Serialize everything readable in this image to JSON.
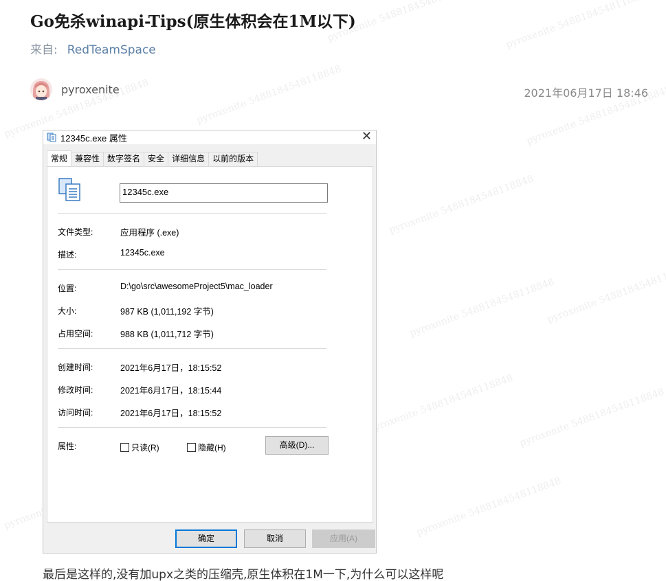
{
  "post": {
    "title": "Go免杀winapi-Tips(原生体积会在1M以下)",
    "source_label": "来自:",
    "source_name": "RedTeamSpace",
    "author": "pyroxenite",
    "date": "2021年06月17日 18:46",
    "body_text": "最后是这样的,没有加upx之类的压缩壳,原生体积在1M一下,为什么可以这样呢"
  },
  "watermark_text": "pyroxenite 5488184548118848",
  "dialog": {
    "title": "12345c.exe 属性",
    "close_glyph": "✕",
    "tabs": [
      {
        "label": "常规",
        "active": true
      },
      {
        "label": "兼容性",
        "active": false
      },
      {
        "label": "数字签名",
        "active": false
      },
      {
        "label": "安全",
        "active": false
      },
      {
        "label": "详细信息",
        "active": false
      },
      {
        "label": "以前的版本",
        "active": false
      }
    ],
    "filename": "12345c.exe",
    "fields": {
      "type_label": "文件类型:",
      "type_value": "应用程序 (.exe)",
      "desc_label": "描述:",
      "desc_value": "12345c.exe",
      "location_label": "位置:",
      "location_value": "D:\\go\\src\\awesomeProject5\\mac_loader",
      "size_label": "大小:",
      "size_value": "987 KB (1,011,192 字节)",
      "disk_label": "占用空间:",
      "disk_value": "988 KB (1,011,712 字节)",
      "created_label": "创建时间:",
      "created_value": "2021年6月17日，18:15:52",
      "modified_label": "修改时间:",
      "modified_value": "2021年6月17日，18:15:44",
      "accessed_label": "访问时间:",
      "accessed_value": "2021年6月17日，18:15:52",
      "attr_label": "属性:"
    },
    "checkboxes": {
      "readonly": {
        "label": "只读(R)",
        "checked": false
      },
      "hidden": {
        "label": "隐藏(H)",
        "checked": false
      }
    },
    "buttons": {
      "advanced": "高级(D)...",
      "ok": "确定",
      "cancel": "取消",
      "apply": "应用(A)"
    }
  },
  "colors": {
    "source_link": "#5b7fa6",
    "default_button_border": "#0078d7"
  }
}
